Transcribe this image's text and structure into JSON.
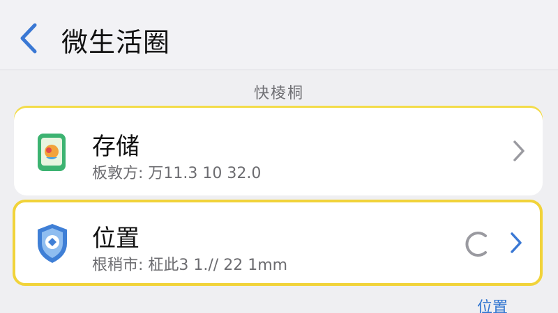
{
  "header": {
    "title": "微生活圈",
    "back_icon": "chevron-left-icon"
  },
  "section": {
    "label": "快棱桐"
  },
  "items": [
    {
      "title": "存储",
      "subtitle": "板敦方: 万11.3 10 32.0",
      "icon": "app-storage-icon",
      "accent": "#3cb371"
    },
    {
      "title": "位置",
      "subtitle": "根稍市: 柾此3 1.// 22 1mm",
      "icon": "location-shield-icon",
      "accent": "#3f7fd6"
    }
  ],
  "footer": {
    "link_label": "位置"
  },
  "colors": {
    "accent_blue": "#2f74d0",
    "highlight_yellow": "#f1d33a"
  }
}
